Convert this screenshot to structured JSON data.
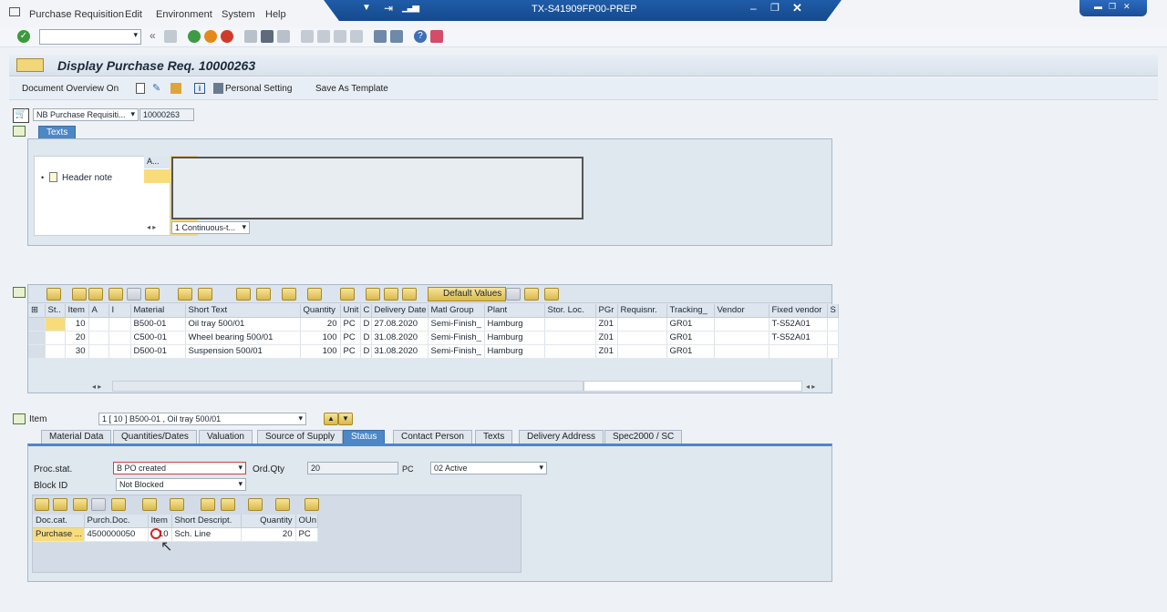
{
  "menu": [
    "Purchase Requisition",
    "Edit",
    "Environment",
    "System",
    "Help"
  ],
  "window_title": "TX-S41909FP00-PREP",
  "title": "Display Purchase Req. 10000263",
  "app_toolbar": {
    "document_overview": "Document Overview On",
    "personal_setting": "Personal Setting",
    "save_template": "Save As Template"
  },
  "header": {
    "doc_type": "NB Purchase Requisiti...",
    "doc_number": "10000263",
    "texts_tab": "Texts",
    "text_col": "A...",
    "header_note": "Header note",
    "format": "1 Continuous-t..."
  },
  "items_toolbar": {
    "default_values": "Default Values"
  },
  "items": {
    "columns": [
      "St..",
      "Item",
      "A",
      "I",
      "Material",
      "Short Text",
      "Quantity",
      "Unit",
      "C",
      "Delivery Date",
      "Matl Group",
      "Plant",
      "Stor. Loc.",
      "PGr",
      "Requisnr.",
      "Tracking_",
      "Vendor",
      "Fixed vendor",
      "S"
    ],
    "rows": [
      [
        "",
        "10",
        "",
        "",
        "B500-01",
        "Oil tray 500/01",
        "20",
        "PC",
        "D",
        "27.08.2020",
        "Semi-Finish_",
        "Hamburg",
        "",
        "Z01",
        "",
        "GR01",
        "",
        "T-S52A01",
        ""
      ],
      [
        "",
        "20",
        "",
        "",
        "C500-01",
        "Wheel bearing 500/01",
        "100",
        "PC",
        "D",
        "31.08.2020",
        "Semi-Finish_",
        "Hamburg",
        "",
        "Z01",
        "",
        "GR01",
        "",
        "T-S52A01",
        ""
      ],
      [
        "",
        "30",
        "",
        "",
        "D500-01",
        "Suspension 500/01",
        "100",
        "PC",
        "D",
        "31.08.2020",
        "Semi-Finish_",
        "Hamburg",
        "",
        "Z01",
        "",
        "GR01",
        "",
        "",
        ""
      ]
    ]
  },
  "item_detail": {
    "label": "Item",
    "selector": "1 [ 10 ] B500-01 , Oil tray 500/01",
    "tabs": [
      "Material Data",
      "Quantities/Dates",
      "Valuation",
      "Source of Supply",
      "Status",
      "Contact Person",
      "Texts",
      "Delivery Address",
      "Spec2000 / SC"
    ],
    "active_tab": "Status",
    "proc_stat_label": "Proc.stat.",
    "proc_stat_value": "B PO created",
    "ord_qty_label": "Ord.Qty",
    "ord_qty_value": "20",
    "ord_qty_unit": "PC",
    "status_value": "02 Active",
    "block_id_label": "Block ID",
    "block_id_value": "Not Blocked",
    "followon": {
      "columns": [
        "Doc.cat.",
        "Purch.Doc.",
        "Item",
        "Short Descript.",
        "Quantity",
        "OUn"
      ],
      "rows": [
        [
          "Purchase ...",
          "4500000050",
          "10",
          "Sch. Line",
          "20",
          "PC"
        ]
      ]
    }
  }
}
